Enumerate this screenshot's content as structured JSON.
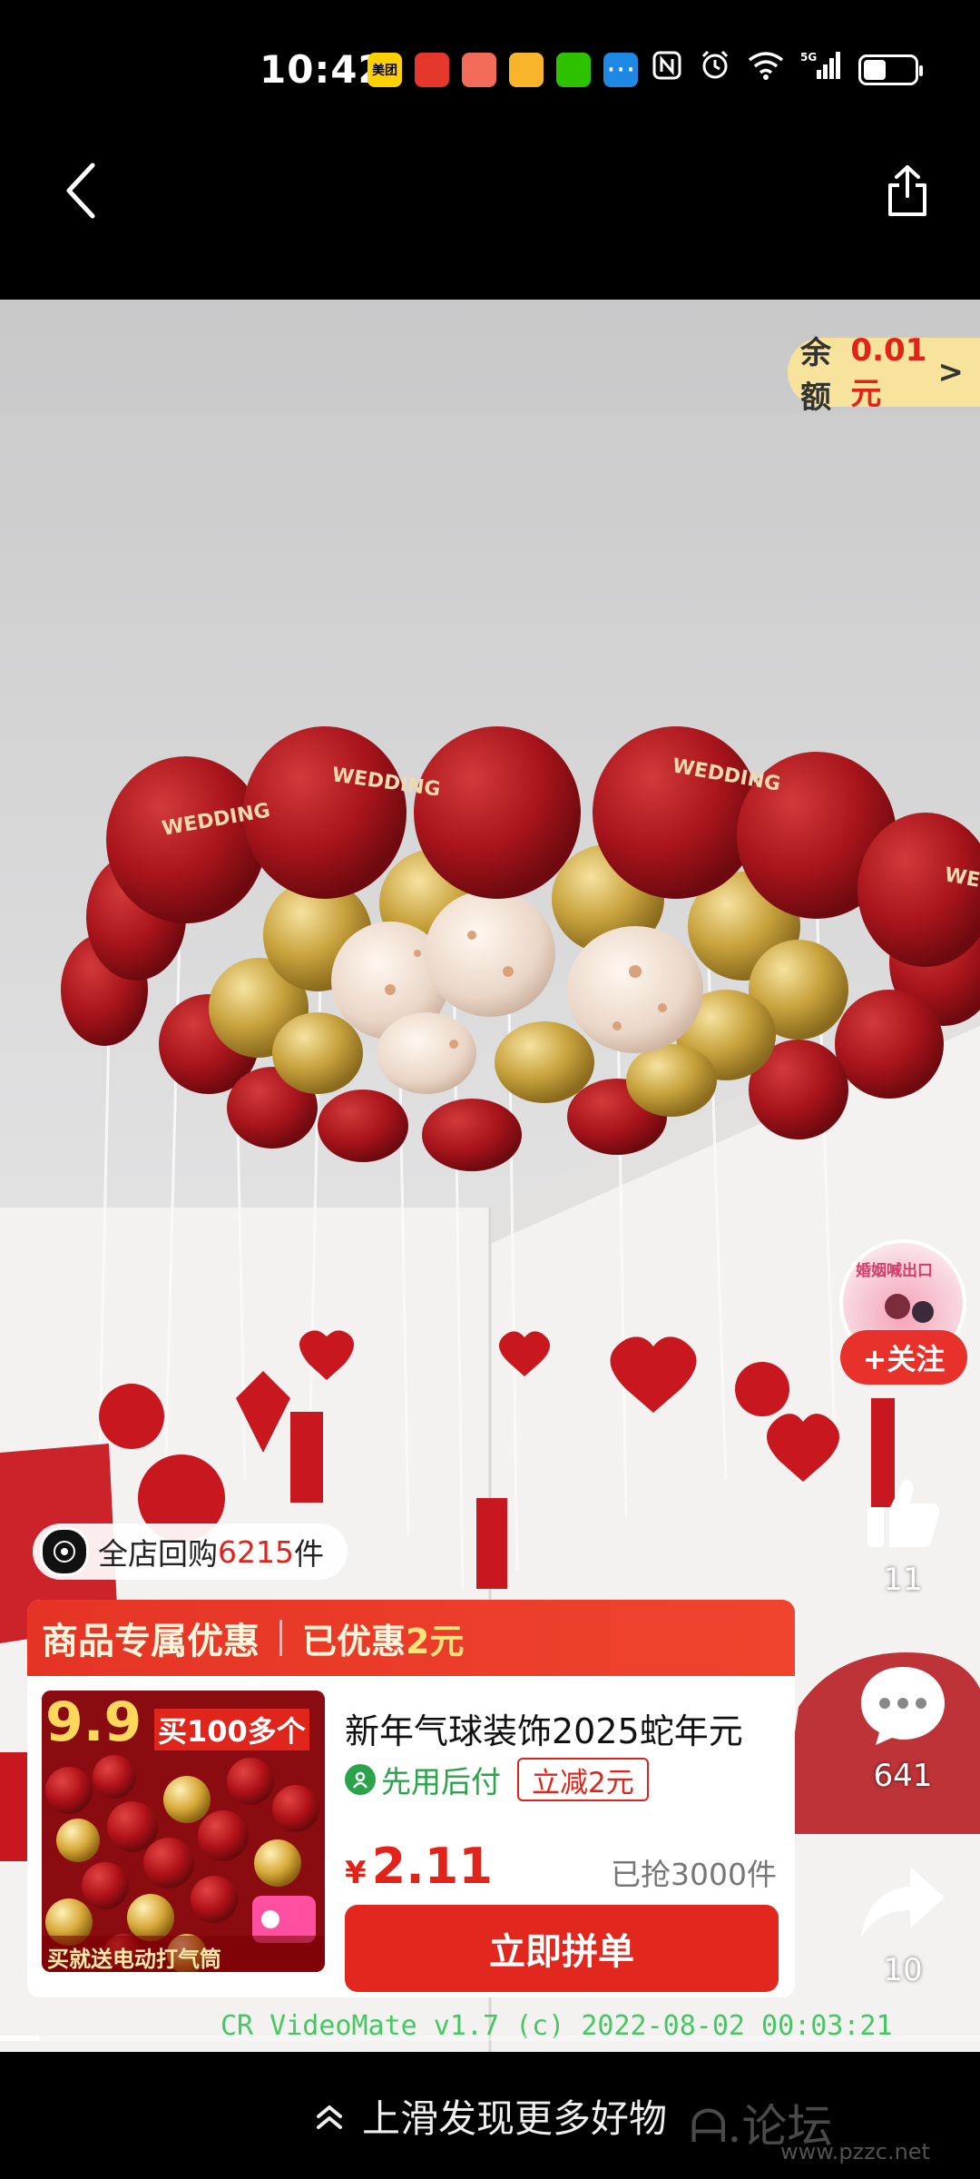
{
  "status_bar": {
    "time": "10:42",
    "app_icons": [
      {
        "name": "meituan-icon",
        "label": "美团",
        "color": "#ffd100"
      },
      {
        "name": "app-red-icon",
        "label": "",
        "color": "#e5372c"
      },
      {
        "name": "app-pig-icon",
        "label": "",
        "color": "#f36c5a"
      },
      {
        "name": "weibo-icon",
        "label": "",
        "color": "#f8b52c"
      },
      {
        "name": "wechat-icon",
        "label": "",
        "color": "#2dc100"
      },
      {
        "name": "app-blue-icon",
        "label": "",
        "color": "#1e88e5"
      }
    ],
    "more": "···",
    "network": "5G",
    "battery_level": 0.45
  },
  "video_overlay": {
    "balance_label": "余额",
    "balance_amount": "0.01元",
    "balance_arrow": ">",
    "follow_label": "+关注",
    "avatar_tag": "婚姻喊出口",
    "like_count": "11",
    "comment_count": "641",
    "share_count": "10",
    "repurchase_prefix": "全店回购",
    "repurchase_count": "6215",
    "repurchase_suffix": "件",
    "watermark": "CR VideoMate v1.7 (c) 2022-08-02 00:03:21",
    "playback_progress": 0.04
  },
  "product_card": {
    "header_title": "商品专属优惠",
    "header_discount_prefix": "已优惠",
    "header_discount_amount": "2元",
    "thumb_promo_price": "9.9",
    "thumb_promo_text": "买100多个",
    "thumb_bottom_text": "买就送电动打气筒",
    "title": "新年气球装饰2025蛇年元",
    "pay_later": "先用后付",
    "discount_tag": "立减2元",
    "currency": "¥",
    "price": "2.11",
    "sold": "已抢3000件",
    "buy_button": "立即拼单"
  },
  "bottom_bar": {
    "swipe_hint": "上滑发现更多好物",
    "forum_watermark": "ᗩ.论坛",
    "forum_url": "www.pzzc.net"
  }
}
